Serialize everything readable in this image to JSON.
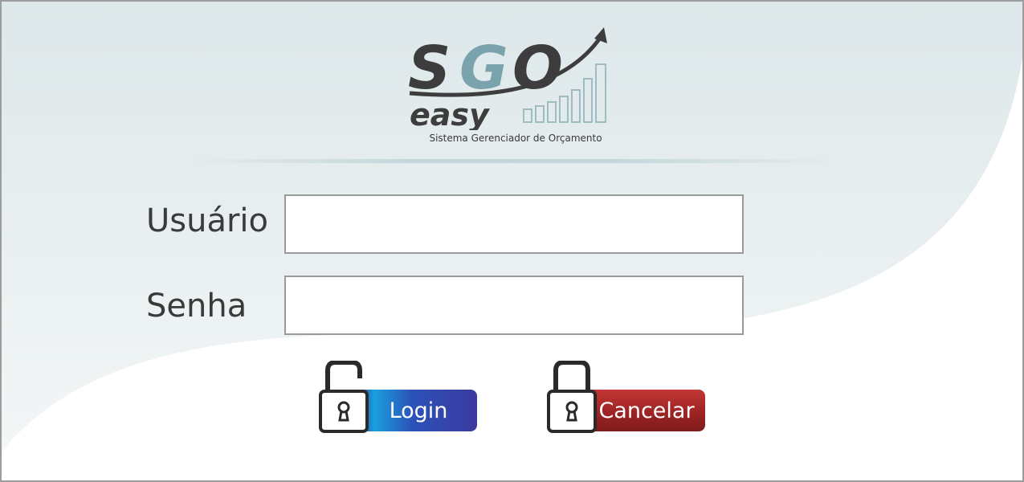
{
  "logo": {
    "brand_prefix": "S",
    "brand_highlight": "G",
    "brand_suffix": "O",
    "brand_sub": "easy",
    "tagline": "Sistema Gerenciador de Orçamento"
  },
  "form": {
    "user_label": "Usuário",
    "user_value": "",
    "password_label": "Senha",
    "password_value": ""
  },
  "buttons": {
    "login_label": "Login",
    "cancel_label": "Cancelar"
  },
  "colors": {
    "login_bar": "#2c4aa8",
    "cancel_bar": "#9e2424",
    "logo_dark": "#3d3d3d",
    "logo_accent": "#7aa3ad"
  }
}
